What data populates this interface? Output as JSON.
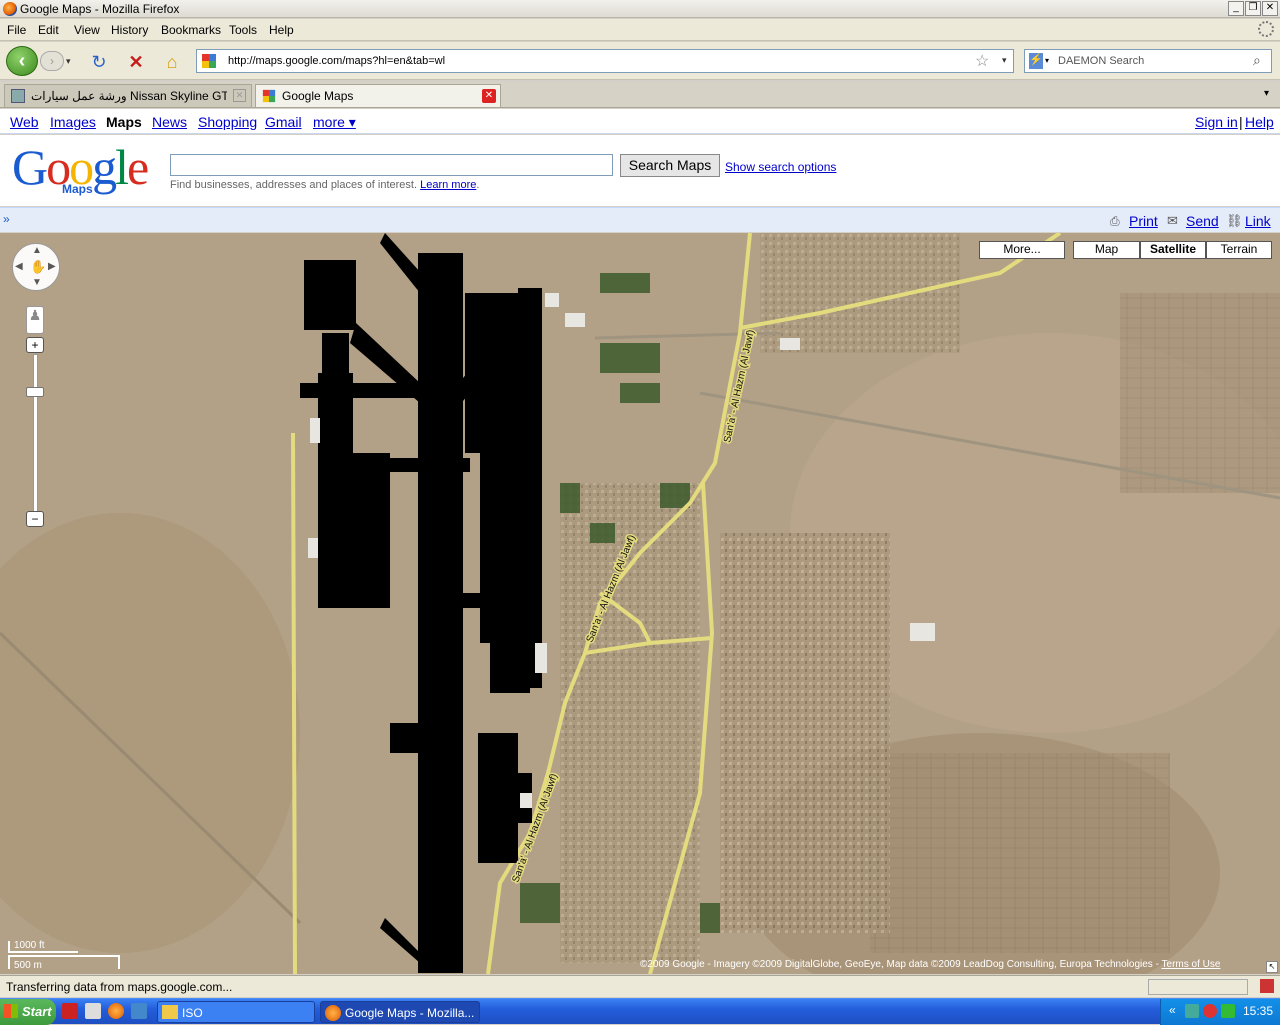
{
  "window": {
    "title": "Google Maps - Mozilla Firefox"
  },
  "menu": [
    "File",
    "Edit",
    "View",
    "History",
    "Bookmarks",
    "Tools",
    "Help"
  ],
  "nav": {
    "url": "http://maps.google.com/maps?hl=en&tab=wl",
    "search_placeholder": "DAEMON Search"
  },
  "tabs": [
    {
      "label": "ورشة عمل سيارات Nissan Skyline GTR..."
    },
    {
      "label": "Google Maps"
    }
  ],
  "gbar": {
    "links": [
      "Web",
      "Images",
      "Maps",
      "News",
      "Shopping",
      "Gmail",
      "more ▾"
    ],
    "sign_in": "Sign in",
    "sep": "|",
    "help": "Help"
  },
  "header": {
    "logo": "Google",
    "logo_sub": "Maps",
    "search_button": "Search Maps",
    "search_options": "Show search options",
    "hint": "Find businesses, addresses and places of interest.",
    "learn_more": "Learn more"
  },
  "toolbar": {
    "expand": "»",
    "print": "Print",
    "send": "Send",
    "link": "Link"
  },
  "map": {
    "more_button": "More...",
    "types": [
      "Map",
      "Satellite",
      "Terrain"
    ],
    "selected_type": "Satellite",
    "road_label": "San'a' - Al Hazm (Al Jawf)",
    "scale_ft": "1000 ft",
    "scale_m": "500 m",
    "copyright": "©2009 Google - Imagery ©2009 DigitalGlobe, GeoEye, Map data ©2009 LeadDog Consulting, Europa Technologies -",
    "terms": "Terms of Use"
  },
  "status": {
    "text": "Transferring data from maps.google.com..."
  },
  "taskbar": {
    "start": "Start",
    "items": [
      "ISO",
      "Google Maps - Mozilla..."
    ],
    "clock": "15:35"
  }
}
